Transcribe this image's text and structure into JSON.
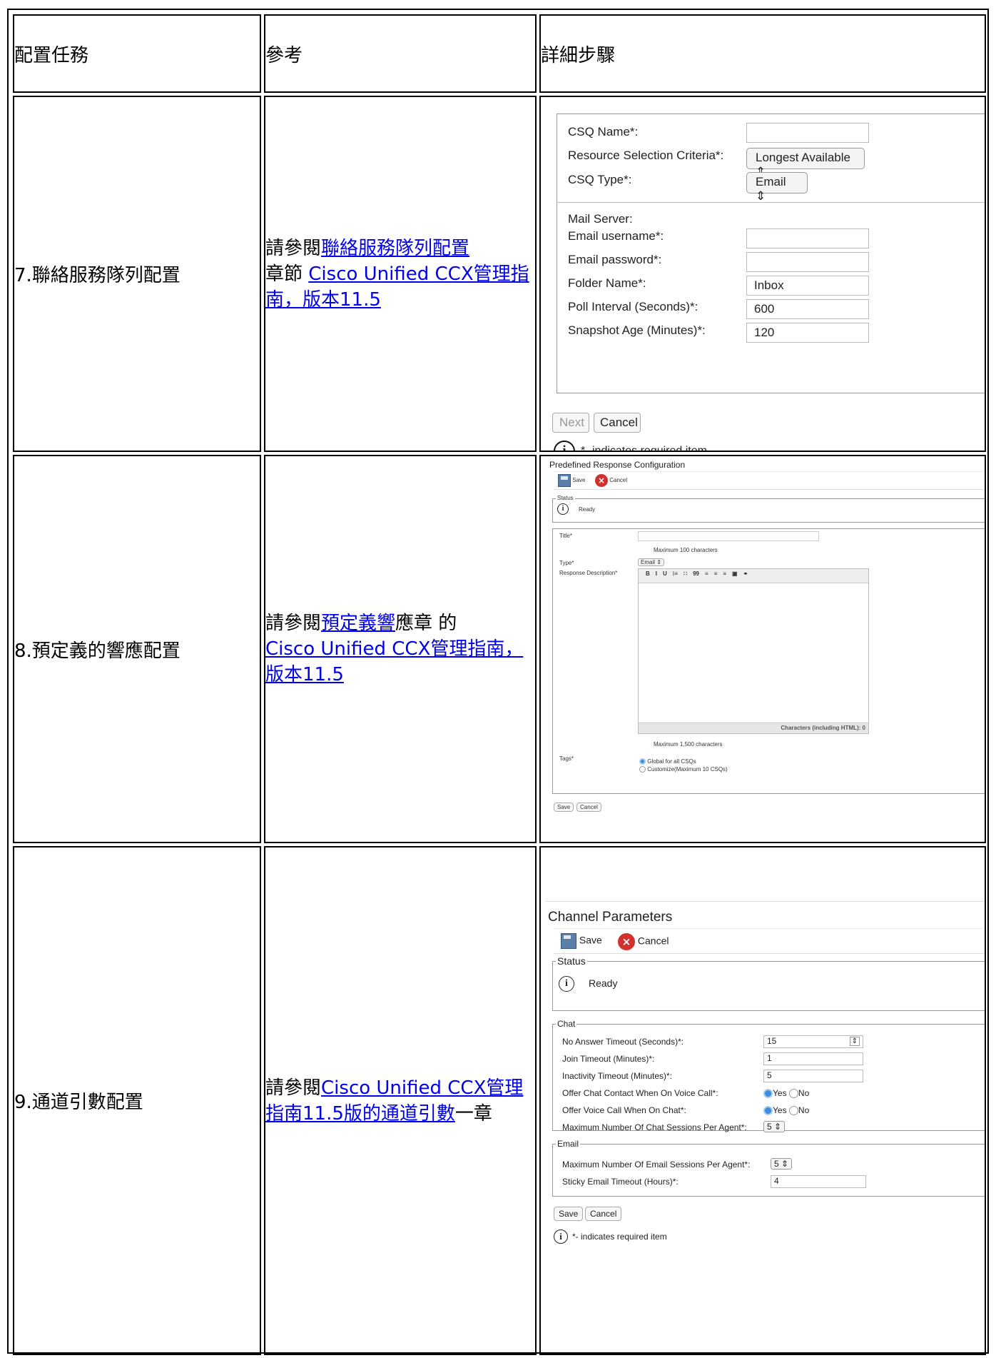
{
  "table": {
    "headers": [
      "配置任務",
      "參考",
      "詳細步驟"
    ],
    "rows": [
      {
        "task": "7.聯絡服務隊列配置",
        "ref_prefix": "請參閱",
        "ref_link1": "聯絡服務隊列配置",
        "ref_mid": "章節 ",
        "ref_link2": "Cisco Unified CCX管理指南，版本11.5",
        "ref_suffix": ""
      },
      {
        "task": "8.預定義的響應配置",
        "ref_prefix": "請參閱",
        "ref_link1": "預定義響",
        "ref_mid": "應章 的 ",
        "ref_link2": "Cisco Unified CCX管理指南，版本11.5",
        "ref_suffix": ""
      },
      {
        "task": "9.通道引數配置",
        "ref_prefix": "請參閱",
        "ref_link1": "Cisco Unified CCX管理指南11.5版的通道引數",
        "ref_mid": "",
        "ref_link2": "",
        "ref_suffix": "一章"
      }
    ]
  },
  "csq_form": {
    "csq_name_label": "CSQ Name*:",
    "csq_name_value": "",
    "resource_label": "Resource Selection Criteria*:",
    "resource_value": "Longest Available",
    "csq_type_label": "CSQ Type*:",
    "csq_type_value": "Email",
    "mail_server_label": "Mail Server:",
    "email_username_label": "Email username*:",
    "email_username_value": "",
    "email_password_label": "Email password*:",
    "email_password_value": "",
    "folder_label": "Folder Name*:",
    "folder_value": "Inbox",
    "poll_label": "Poll Interval (Seconds)*:",
    "poll_value": "600",
    "snapshot_label": "Snapshot Age (Minutes)*:",
    "snapshot_value": "120",
    "next_label": "Next",
    "cancel_label": "Cancel",
    "info_glyph": "i",
    "required_note": "*- indicates required item"
  },
  "predefined": {
    "title": "Predefined Response Configuration",
    "save_label": "Save",
    "cancel_label": "Cancel",
    "status_legend": "Status",
    "status_value": "Ready",
    "info_glyph": "i",
    "title_label": "Title*",
    "title_value": "",
    "title_hint": "Maximum 100 characters",
    "type_label": "Type*",
    "type_value": "Email",
    "desc_label": "Response Description*",
    "editor_buttons": [
      "B",
      "I",
      "U",
      "⁝≡",
      "∷",
      "99",
      "≡",
      "≡",
      "≡",
      "▣",
      "⚭"
    ],
    "char_counter": "Characters (including HTML): 0",
    "desc_hint": "Maximum 1,500 characters",
    "tags_label": "Tags*",
    "tag_option_global": "Global for all CSQs",
    "tag_option_custom": "Customize(Maximum 10 CSQs)",
    "bottom_save": "Save",
    "bottom_cancel": "Cancel"
  },
  "channel": {
    "title": "Channel Parameters",
    "save_label": "Save",
    "cancel_label": "Cancel",
    "status_legend": "Status",
    "status_value": "Ready",
    "info_glyph": "i",
    "chat_legend": "Chat",
    "no_answer_label": "No Answer Timeout (Seconds)*:",
    "no_answer_value": "15",
    "join_label": "Join Timeout (Minutes)*:",
    "join_value": "1",
    "inactivity_label": "Inactivity Timeout (Minutes)*:",
    "inactivity_value": "5",
    "offer_chat_label": "Offer Chat Contact When On Voice Call*:",
    "offer_voice_label": "Offer Voice Call When On Chat*:",
    "yes_label": "Yes",
    "no_label": "No",
    "max_chat_label": "Maximum Number Of Chat Sessions Per Agent*:",
    "max_chat_value": "5",
    "email_legend": "Email",
    "max_email_label": "Maximum Number Of Email Sessions Per Agent*:",
    "max_email_value": "5",
    "sticky_label": "Sticky Email Timeout (Hours)*:",
    "sticky_value": "4",
    "bottom_save": "Save",
    "bottom_cancel": "Cancel",
    "required_note": "*- indicates required item"
  }
}
